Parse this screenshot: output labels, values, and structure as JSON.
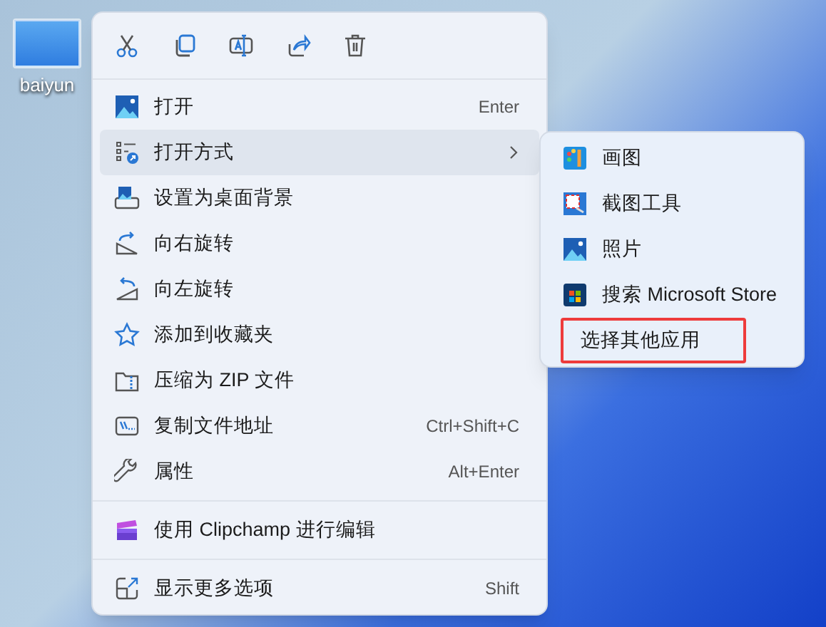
{
  "desktop_icon": {
    "label": "baiyun",
    "selected": true
  },
  "toolbar": [
    {
      "kind": "cut"
    },
    {
      "kind": "copy"
    },
    {
      "kind": "rename"
    },
    {
      "kind": "share"
    },
    {
      "kind": "delete"
    }
  ],
  "menu": [
    {
      "kind": "item",
      "label": "打开",
      "shortcut": "Enter",
      "selected": false
    },
    {
      "kind": "submenu",
      "label": "打开方式",
      "selected": true
    },
    {
      "kind": "item",
      "label": "设置为桌面背景",
      "selected": false
    },
    {
      "kind": "item",
      "label": "向右旋转",
      "selected": false
    },
    {
      "kind": "item",
      "label": "向左旋转",
      "selected": false
    },
    {
      "kind": "item",
      "label": "添加到收藏夹",
      "selected": false
    },
    {
      "kind": "item",
      "label": "压缩为 ZIP 文件",
      "selected": false
    },
    {
      "kind": "item",
      "label": "复制文件地址",
      "shortcut": "Ctrl+Shift+C",
      "selected": false
    },
    {
      "kind": "item",
      "label": "属性",
      "shortcut": "Alt+Enter",
      "selected": false
    },
    {
      "kind": "divider"
    },
    {
      "kind": "item",
      "label": "使用 Clipchamp 进行编辑",
      "selected": false
    },
    {
      "kind": "divider"
    },
    {
      "kind": "item",
      "label": "显示更多选项",
      "shortcut": "Shift",
      "selected": false
    }
  ],
  "submenu": [
    {
      "label": "画图",
      "highlighted": false
    },
    {
      "label": "截图工具",
      "highlighted": false
    },
    {
      "label": "照片",
      "highlighted": false
    },
    {
      "label": "搜索 Microsoft Store",
      "highlighted": false
    },
    {
      "label": "选择其他应用",
      "highlighted": true
    }
  ]
}
